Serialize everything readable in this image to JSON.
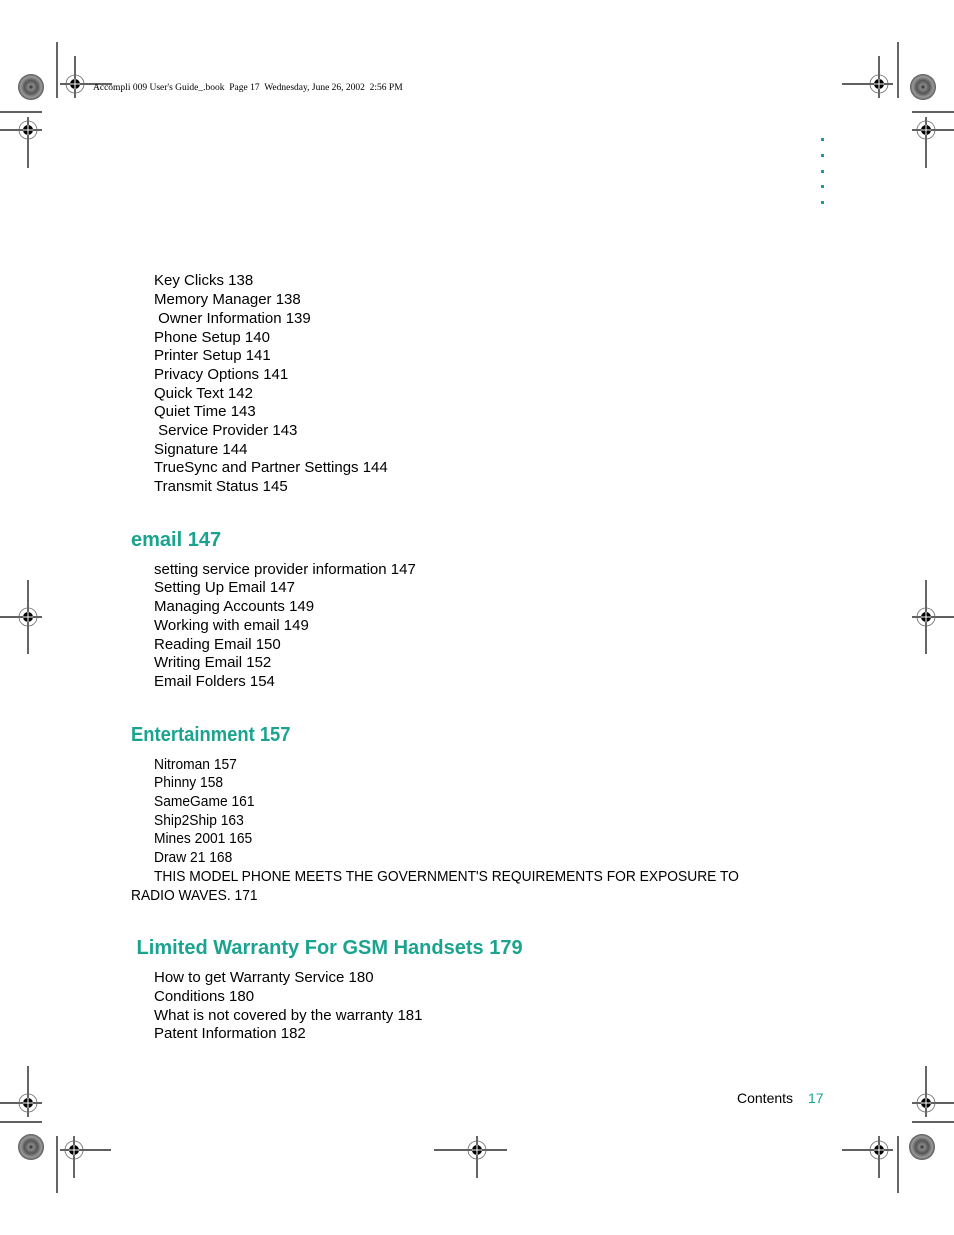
{
  "header": {
    "text": "Accompli 009 User's Guide_.book  Page 17  Wednesday, June 26, 2002  2:56 PM"
  },
  "sections": [
    {
      "heading": "",
      "items": [
        "Key Clicks 138",
        "Memory Manager 138",
        " Owner Information 139",
        "Phone Setup 140",
        "Printer Setup 141",
        "Privacy Options 141",
        "Quick Text 142",
        "Quiet Time 143",
        " Service Provider 143",
        "Signature 144",
        "TrueSync and Partner Settings 144",
        "Transmit Status 145"
      ]
    },
    {
      "heading": "email 147",
      "items": [
        "setting service provider information 147",
        "Setting Up Email 147",
        "Managing Accounts 149",
        "Working with email 149",
        "Reading Email 150",
        "Writing Email 152",
        "Email Folders 154"
      ]
    },
    {
      "heading": "Entertainment 157",
      "items": [
        "Nitroman 157",
        "Phinny 158",
        "SameGame 161",
        "Ship2Ship 163",
        "Mines 2001 165",
        "Draw 21 168",
        "THIS MODEL PHONE MEETS THE GOVERNMENT'S REQUIREMENTS FOR EXPOSURE TO",
        "RADIO WAVES. 171"
      ]
    },
    {
      "heading": " Limited Warranty For GSM Handsets 179",
      "items": [
        "How to get Warranty Service 180",
        "Conditions 180",
        "What is not covered by the warranty 181",
        "Patent Information 182"
      ]
    }
  ],
  "footer": {
    "label": "Contents",
    "page_number": "17"
  },
  "colors": {
    "accent": "#1aa48f",
    "dots": "#1a9aa8"
  },
  "icons": {
    "registration_mark": "crosshair-target-icon",
    "starburst": "starburst-registration-icon",
    "margin_dots": "margin-dot-icon"
  }
}
